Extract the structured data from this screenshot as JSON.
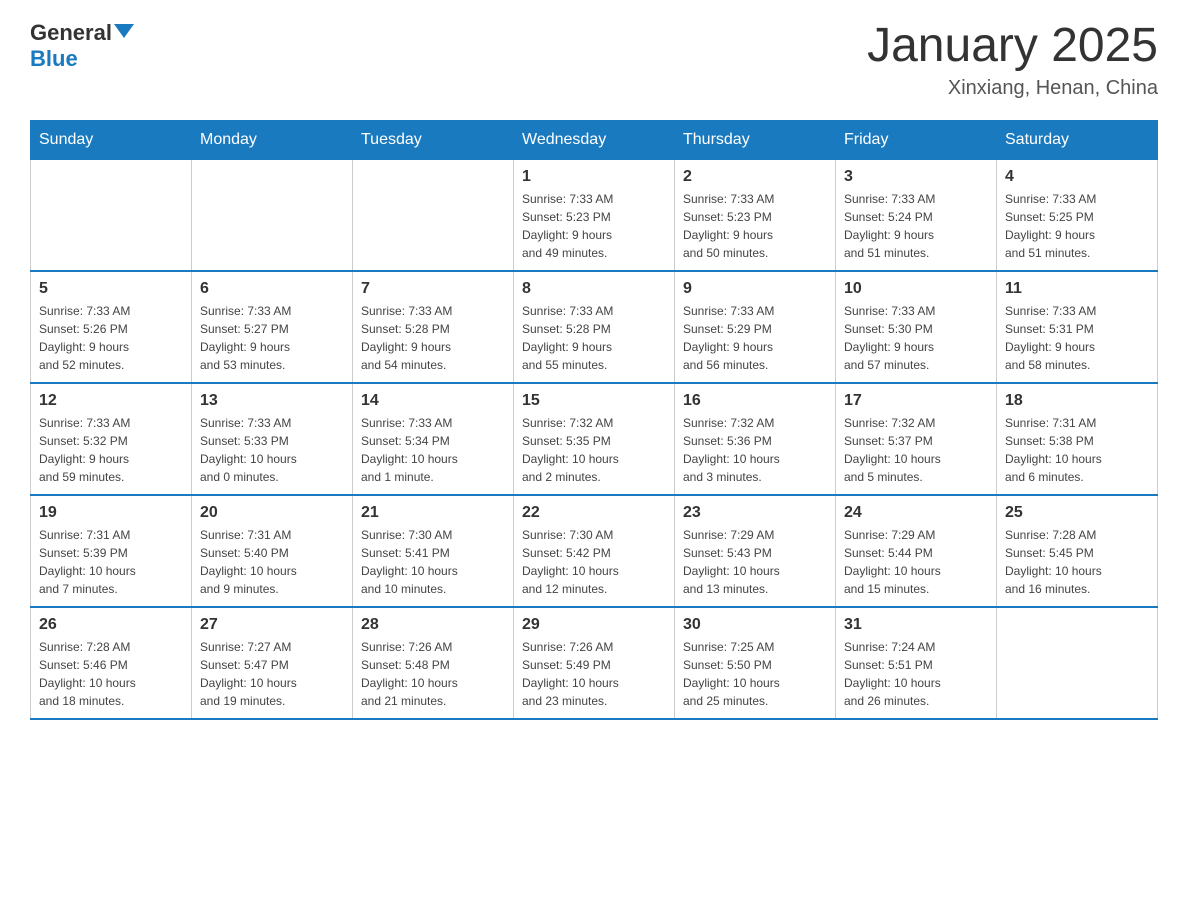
{
  "header": {
    "logo_general": "General",
    "logo_blue": "Blue",
    "month": "January 2025",
    "location": "Xinxiang, Henan, China"
  },
  "days_of_week": [
    "Sunday",
    "Monday",
    "Tuesday",
    "Wednesday",
    "Thursday",
    "Friday",
    "Saturday"
  ],
  "weeks": [
    [
      {
        "day": "",
        "info": ""
      },
      {
        "day": "",
        "info": ""
      },
      {
        "day": "",
        "info": ""
      },
      {
        "day": "1",
        "info": "Sunrise: 7:33 AM\nSunset: 5:23 PM\nDaylight: 9 hours\nand 49 minutes."
      },
      {
        "day": "2",
        "info": "Sunrise: 7:33 AM\nSunset: 5:23 PM\nDaylight: 9 hours\nand 50 minutes."
      },
      {
        "day": "3",
        "info": "Sunrise: 7:33 AM\nSunset: 5:24 PM\nDaylight: 9 hours\nand 51 minutes."
      },
      {
        "day": "4",
        "info": "Sunrise: 7:33 AM\nSunset: 5:25 PM\nDaylight: 9 hours\nand 51 minutes."
      }
    ],
    [
      {
        "day": "5",
        "info": "Sunrise: 7:33 AM\nSunset: 5:26 PM\nDaylight: 9 hours\nand 52 minutes."
      },
      {
        "day": "6",
        "info": "Sunrise: 7:33 AM\nSunset: 5:27 PM\nDaylight: 9 hours\nand 53 minutes."
      },
      {
        "day": "7",
        "info": "Sunrise: 7:33 AM\nSunset: 5:28 PM\nDaylight: 9 hours\nand 54 minutes."
      },
      {
        "day": "8",
        "info": "Sunrise: 7:33 AM\nSunset: 5:28 PM\nDaylight: 9 hours\nand 55 minutes."
      },
      {
        "day": "9",
        "info": "Sunrise: 7:33 AM\nSunset: 5:29 PM\nDaylight: 9 hours\nand 56 minutes."
      },
      {
        "day": "10",
        "info": "Sunrise: 7:33 AM\nSunset: 5:30 PM\nDaylight: 9 hours\nand 57 minutes."
      },
      {
        "day": "11",
        "info": "Sunrise: 7:33 AM\nSunset: 5:31 PM\nDaylight: 9 hours\nand 58 minutes."
      }
    ],
    [
      {
        "day": "12",
        "info": "Sunrise: 7:33 AM\nSunset: 5:32 PM\nDaylight: 9 hours\nand 59 minutes."
      },
      {
        "day": "13",
        "info": "Sunrise: 7:33 AM\nSunset: 5:33 PM\nDaylight: 10 hours\nand 0 minutes."
      },
      {
        "day": "14",
        "info": "Sunrise: 7:33 AM\nSunset: 5:34 PM\nDaylight: 10 hours\nand 1 minute."
      },
      {
        "day": "15",
        "info": "Sunrise: 7:32 AM\nSunset: 5:35 PM\nDaylight: 10 hours\nand 2 minutes."
      },
      {
        "day": "16",
        "info": "Sunrise: 7:32 AM\nSunset: 5:36 PM\nDaylight: 10 hours\nand 3 minutes."
      },
      {
        "day": "17",
        "info": "Sunrise: 7:32 AM\nSunset: 5:37 PM\nDaylight: 10 hours\nand 5 minutes."
      },
      {
        "day": "18",
        "info": "Sunrise: 7:31 AM\nSunset: 5:38 PM\nDaylight: 10 hours\nand 6 minutes."
      }
    ],
    [
      {
        "day": "19",
        "info": "Sunrise: 7:31 AM\nSunset: 5:39 PM\nDaylight: 10 hours\nand 7 minutes."
      },
      {
        "day": "20",
        "info": "Sunrise: 7:31 AM\nSunset: 5:40 PM\nDaylight: 10 hours\nand 9 minutes."
      },
      {
        "day": "21",
        "info": "Sunrise: 7:30 AM\nSunset: 5:41 PM\nDaylight: 10 hours\nand 10 minutes."
      },
      {
        "day": "22",
        "info": "Sunrise: 7:30 AM\nSunset: 5:42 PM\nDaylight: 10 hours\nand 12 minutes."
      },
      {
        "day": "23",
        "info": "Sunrise: 7:29 AM\nSunset: 5:43 PM\nDaylight: 10 hours\nand 13 minutes."
      },
      {
        "day": "24",
        "info": "Sunrise: 7:29 AM\nSunset: 5:44 PM\nDaylight: 10 hours\nand 15 minutes."
      },
      {
        "day": "25",
        "info": "Sunrise: 7:28 AM\nSunset: 5:45 PM\nDaylight: 10 hours\nand 16 minutes."
      }
    ],
    [
      {
        "day": "26",
        "info": "Sunrise: 7:28 AM\nSunset: 5:46 PM\nDaylight: 10 hours\nand 18 minutes."
      },
      {
        "day": "27",
        "info": "Sunrise: 7:27 AM\nSunset: 5:47 PM\nDaylight: 10 hours\nand 19 minutes."
      },
      {
        "day": "28",
        "info": "Sunrise: 7:26 AM\nSunset: 5:48 PM\nDaylight: 10 hours\nand 21 minutes."
      },
      {
        "day": "29",
        "info": "Sunrise: 7:26 AM\nSunset: 5:49 PM\nDaylight: 10 hours\nand 23 minutes."
      },
      {
        "day": "30",
        "info": "Sunrise: 7:25 AM\nSunset: 5:50 PM\nDaylight: 10 hours\nand 25 minutes."
      },
      {
        "day": "31",
        "info": "Sunrise: 7:24 AM\nSunset: 5:51 PM\nDaylight: 10 hours\nand 26 minutes."
      },
      {
        "day": "",
        "info": ""
      }
    ]
  ]
}
